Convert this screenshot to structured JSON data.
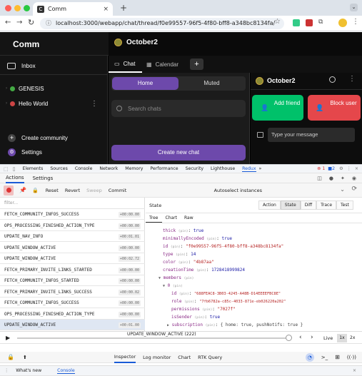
{
  "browser": {
    "tab_title": "Comm",
    "url": "localhost:3000/webapp/chat/thread/f0e99557-96f5-4f80-bff8-a348bc8134fa/"
  },
  "app": {
    "brand": "Comm",
    "sidebar": {
      "inbox": "Inbox",
      "communities": [
        {
          "name": "GENESIS"
        },
        {
          "name": "Hello World"
        }
      ],
      "create_community": "Create community",
      "settings": "Settings"
    },
    "community_title": "October2",
    "nav_tabs": [
      "Chat",
      "Calendar"
    ],
    "chat_list": {
      "tabs": [
        "Home",
        "Muted"
      ],
      "search_placeholder": "Search chats",
      "create_button": "Create new chat"
    },
    "thread": {
      "title": "October2",
      "add_friend": "Add friend",
      "block_user": "Block user",
      "message_placeholder": "Type your message"
    },
    "colors": {
      "accent": "#6d49ab",
      "green": "#00c16a",
      "red": "#e5474b"
    }
  },
  "devtools": {
    "tabs": [
      "Elements",
      "Sources",
      "Console",
      "Network",
      "Memory",
      "Performance",
      "Security",
      "Lighthouse",
      "Redux"
    ],
    "overflow": "»",
    "errors": "1",
    "warnings": "2",
    "redux_tabs": [
      "Actions",
      "Settings"
    ],
    "toolbar": {
      "reset": "Reset",
      "revert": "Revert",
      "sweep": "Sweep",
      "commit": "Commit",
      "autoselect": "Autoselect instances"
    },
    "filter_placeholder": "filter...",
    "actions": [
      {
        "name": "FETCH_COMMUNITY_INFOS_SUCCESS",
        "time": "+00:00.00"
      },
      {
        "name": "OPS_PROCESSING_FINISHED_ACTION_TYPE",
        "time": "+00:00.00"
      },
      {
        "name": "UPDATE_NAV_INFO",
        "time": "+00:01.01"
      },
      {
        "name": "UPDATE_WINDOW_ACTIVE",
        "time": "+00:00.00"
      },
      {
        "name": "UPDATE_WINDOW_ACTIVE",
        "time": "+00:02.72"
      },
      {
        "name": "FETCH_PRIMARY_INVITE_LINKS_STARTED",
        "time": "+00:00.00"
      },
      {
        "name": "FETCH_COMMUNITY_INFOS_STARTED",
        "time": "+00:00.00"
      },
      {
        "name": "FETCH_PRIMARY_INVITE_LINKS_SUCCESS",
        "time": "+00:00.02"
      },
      {
        "name": "FETCH_COMMUNITY_INFOS_SUCCESS",
        "time": "+00:00.00"
      },
      {
        "name": "OPS_PROCESSING_FINISHED_ACTION_TYPE",
        "time": "+00:00.00"
      },
      {
        "name": "UPDATE_WINDOW_ACTIVE",
        "time": "+00:01.00"
      }
    ],
    "state_label": "State",
    "monitor_tabs": [
      "Action",
      "State",
      "Diff",
      "Trace",
      "Test"
    ],
    "view_tabs": [
      "Tree",
      "Chart",
      "Raw"
    ],
    "tree": {
      "thick": "thick",
      "thick_val": "true",
      "pin": "(pin)",
      "minimallyEncoded": "minimallyEncoded",
      "minimallyEncoded_val": "true",
      "id": "id",
      "id_val": "\"f0e99557-96f5-4f80-bff8-a348bc8134fa\"",
      "type": "type",
      "type_val": "14",
      "color": "color",
      "color_val": "\"4b87aa\"",
      "creationTime": "creationTime",
      "creationTime_val": "1728418999824",
      "members": "members",
      "index0": "0",
      "mid": "id",
      "mid_val": "\"688FEAC8-3B03-4245-A48B-D14EEEEFBC8E\"",
      "role": "role",
      "role_val": "\"7fb6782a-c85c-4033-871e-eb026220a202\"",
      "permissions": "permissions",
      "permissions_val": "\"7027f\"",
      "isSender": "isSender",
      "isSender_val": "true",
      "subscription": "subscription",
      "subscription_val": "{ home: true, pushNotifs: true }"
    },
    "playback": {
      "label": "UPDATE_WINDOW_ACTIVE (222)",
      "live": "Live",
      "speed1": "1x",
      "speed2": "2x"
    },
    "bottom_tabs": [
      "Inspector",
      "Log monitor",
      "Chart",
      "RTK Query"
    ],
    "drawer_tabs": [
      "What's new",
      "Console"
    ]
  }
}
